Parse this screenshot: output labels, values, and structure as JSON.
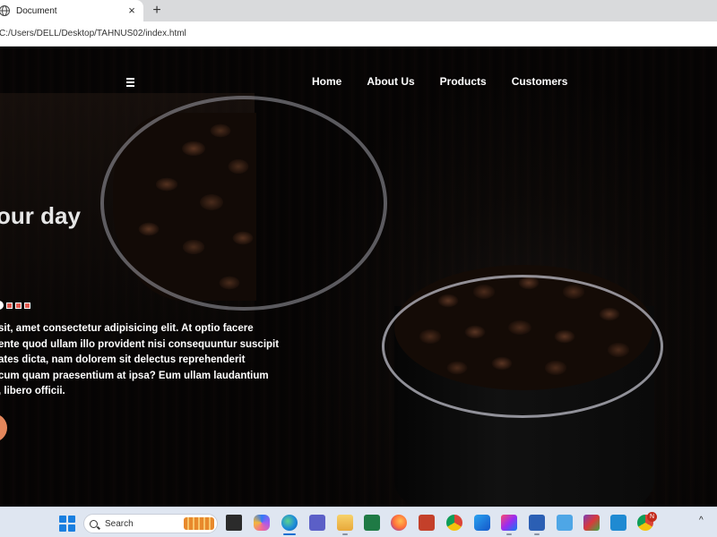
{
  "browser": {
    "tab_title": "Document",
    "tab_close": "×",
    "new_tab": "+",
    "url": "C:/Users/DELL/Desktop/TAHNUS02/index.html"
  },
  "nav": {
    "items": [
      "Home",
      "About Us",
      "Products",
      "Customers"
    ]
  },
  "hero": {
    "heading": "our day",
    "text_lines": [
      "sit, amet consectetur adipisicing elit. At optio facere",
      "ente quod ullam illo provident nisi consequuntur suscipit",
      "ates dicta, nam dolorem sit delectus reprehenderit",
      " cum quam praesentium at ipsa? Eum ullam laudantium",
      ", libero officii."
    ]
  },
  "taskbar": {
    "search_label": "Search",
    "notification_count": "N",
    "chevron": "^",
    "icons": [
      "widgets-icon",
      "copilot-icon",
      "edge-icon",
      "teams-icon",
      "file-explorer-icon",
      "excel-icon",
      "firefox-icon",
      "powerpoint-icon",
      "chrome-icon",
      "app-hex-icon",
      "intellij-icon",
      "word-icon",
      "notepad-icon",
      "winrar-icon",
      "vscode-icon",
      "chrome-profile-icon"
    ]
  },
  "colors": {
    "accent_button": "#e3865b",
    "dot_accent": "#e05a50",
    "taskbar_bg": "#dfe6f1",
    "page_bg": "#050404"
  }
}
